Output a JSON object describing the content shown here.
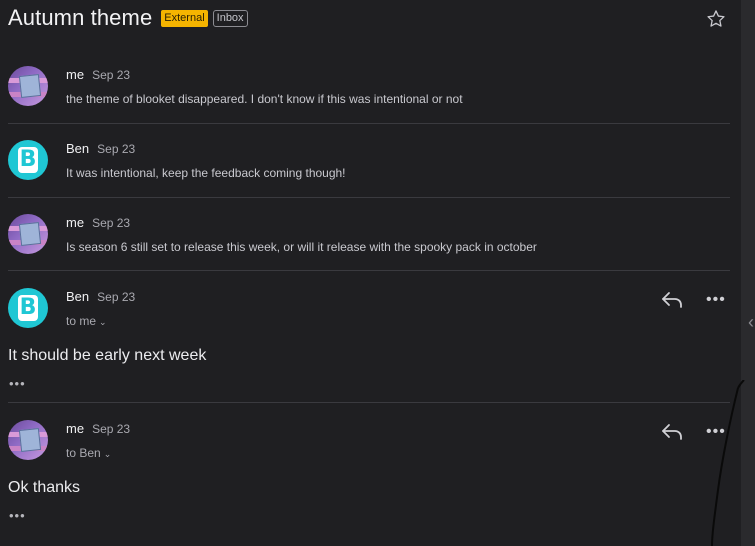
{
  "thread": {
    "subject": "Autumn theme",
    "labels": {
      "external": "External",
      "inbox": "Inbox"
    },
    "star_icon": "star-outline-icon",
    "colors": {
      "background": "#1f1f22",
      "external_badge": "#f5b400",
      "ben_avatar": "#1fc7d4",
      "divider": "#3a3a3f"
    }
  },
  "messages": [
    {
      "sender": "me",
      "date": "Sep 23",
      "snippet": "the theme of blooket disappeared. I don't know if this was intentional or not",
      "avatar": "me-avatar"
    },
    {
      "sender": "Ben",
      "date": "Sep 23",
      "snippet": "It was intentional, keep the feedback coming though!",
      "avatar": "ben-avatar",
      "avatar_letter": "B"
    },
    {
      "sender": "me",
      "date": "Sep 23",
      "snippet": "Is season 6 still set to release this week, or will it release with the spooky pack in october",
      "avatar": "me-avatar"
    },
    {
      "sender": "Ben",
      "date": "Sep 23",
      "to": "to me",
      "body": "It should be early next week",
      "more": "•••",
      "avatar": "ben-avatar",
      "avatar_letter": "B",
      "menu": "•••"
    },
    {
      "sender": "me",
      "date": "Sep 23",
      "to": "to Ben",
      "body": "Ok thanks",
      "more": "•••",
      "avatar": "me-avatar",
      "menu": "•••"
    }
  ]
}
